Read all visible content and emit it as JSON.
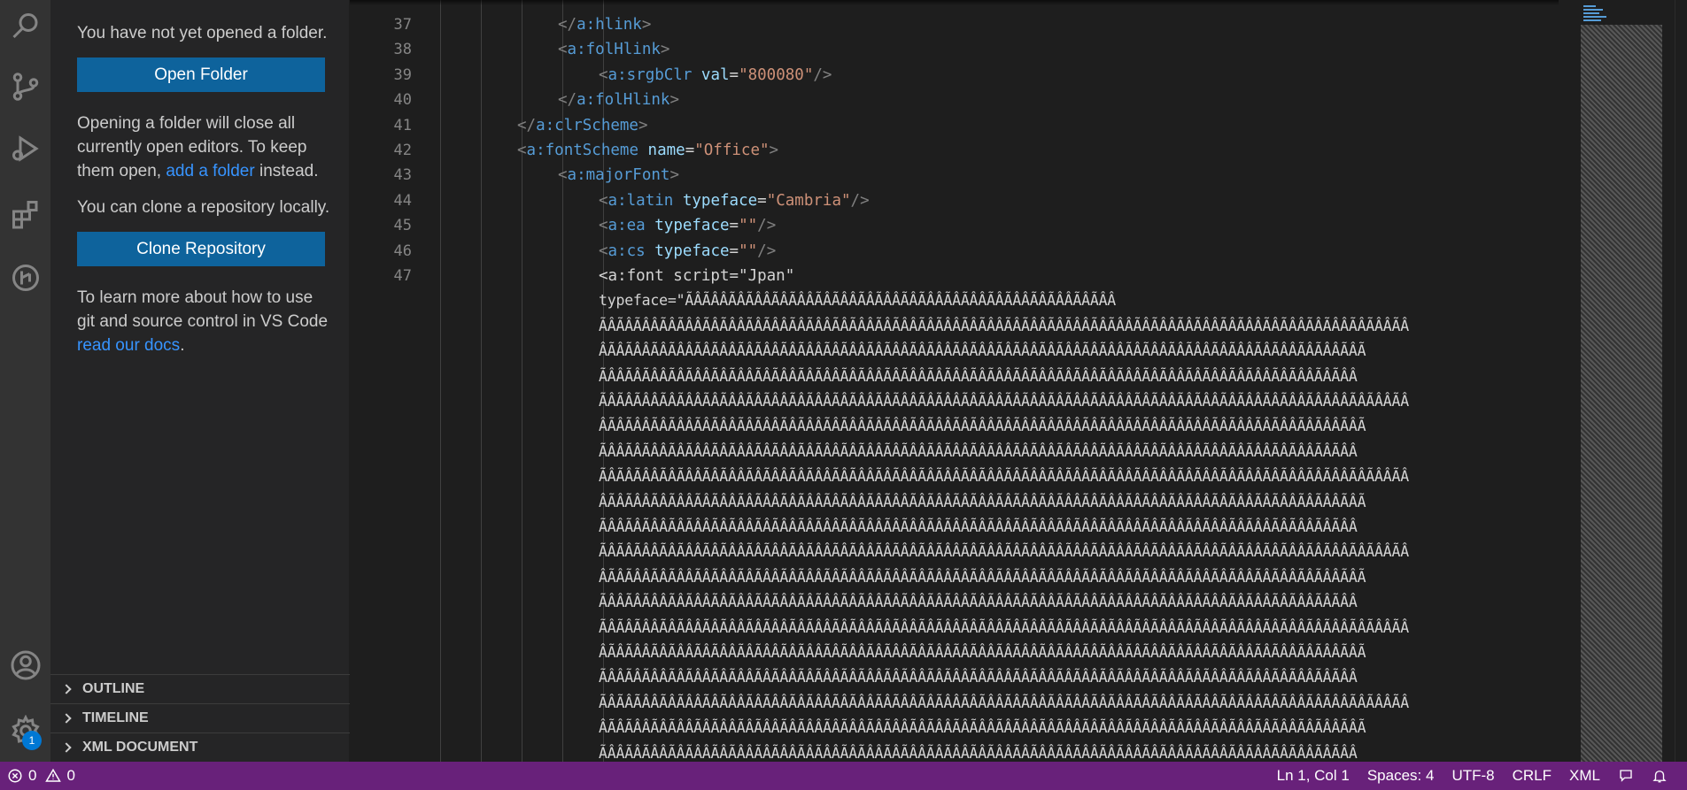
{
  "sidebar": {
    "welcome_text_1": "You have not yet opened a folder.",
    "open_folder_label": "Open Folder",
    "welcome_text_2_pre": "Opening a folder will close all currently open editors. To keep them open, ",
    "welcome_text_2_link": "add a folder",
    "welcome_text_2_post": " instead.",
    "welcome_text_3": "You can clone a repository locally.",
    "clone_repo_label": "Clone Repository",
    "welcome_text_4_pre": "To learn more about how to use git and source control in VS Code ",
    "welcome_text_4_link": "read our docs",
    "welcome_text_4_post": ".",
    "panels": [
      {
        "label": "OUTLINE"
      },
      {
        "label": "TIMELINE"
      },
      {
        "label": "XML DOCUMENT"
      }
    ]
  },
  "activity_bar": {
    "icons": [
      "search-icon",
      "source-control-icon",
      "run-debug-icon",
      "extensions-icon",
      "remote-explorer-icon",
      "account-icon",
      "manage-gear-icon"
    ],
    "badge_count": "1"
  },
  "editor": {
    "line_numbers": [
      "37",
      "38",
      "39",
      "40",
      "41",
      "42",
      "43",
      "44",
      "45",
      "46",
      "47"
    ],
    "lines": {
      "l37": {
        "open": "</",
        "tag": "a:hlink",
        "close": ">"
      },
      "l38": {
        "open": "<",
        "tag": "a:folHlink",
        "close": ">"
      },
      "l39": {
        "open": "<",
        "tag": "a:srgbClr",
        "attr": "val",
        "eq": "=",
        "val": "\"800080\"",
        "close": "/>"
      },
      "l40": {
        "open": "</",
        "tag": "a:folHlink",
        "close": ">"
      },
      "l41": {
        "open": "</",
        "tag": "a:clrScheme",
        "close": ">"
      },
      "l42": {
        "open": "<",
        "tag": "a:fontScheme",
        "attr": "name",
        "eq": "=",
        "val": "\"Office\"",
        "close": ">"
      },
      "l43": {
        "open": "<",
        "tag": "a:majorFont",
        "close": ">"
      },
      "l44": {
        "open": "<",
        "tag": "a:latin",
        "attr": "typeface",
        "eq": "=",
        "val": "\"Cambria\"",
        "close": "/>"
      },
      "l45": {
        "open": "<",
        "tag": "a:ea",
        "attr": "typeface",
        "eq": "=",
        "val": "\"\"",
        "close": "/>"
      },
      "l46": {
        "open": "<",
        "tag": "a:cs",
        "attr": "typeface",
        "eq": "=",
        "val": "\"\"",
        "close": "/>"
      },
      "l47": {
        "text": "<a:font script=\"Jpan\""
      },
      "l47_typeface": "typeface=\"ÃÂÃÂÂÃÂÃÂÂÃÂÃÂÂÃÂÃÂÂÃÂÃÂÂÃÂÃÂÂÃÂÃÂÂÃÂÃÂÂÃÂÃÂÂÃÂÃÂÂ"
    },
    "garbled_row_a": "ÃÂÃÂÃÂÂÃÂÃÂÂÃÂÃÂÂÃÂÃÂÂÃÂÃÂÂÃÂÃÂÂÃÂÃÂÂÃÂÃÂÂÃÂÃÂÂÃÂÃÂÂÃÂÃÂÂÃÂÃÂÂÃÂÃÂÂÃÂÃÂÂÃÂÃÂÂÃÂÃÂÂÃÂÃÂÂÃÂÃÂÂÃÂ",
    "garbled_row_b": "ÂÃÂÃÂÂÃÂÃÂÂÃÂÃÂÂÃÂÃÂÂÃÂÃÂÂÃÂÃÂÂÃÂÃÂÂÃÂÃÂÂÃÂÃÂÂÃÂÃÂÂÃÂÃÂÂÃÂÃÂÂÃÂÃÂÂÃÂÃÂÂÃÂÃÂÂÃÂÃÂÂÃÂÃÂÂÃÂÃ",
    "garbled_row_c": "ÃÂÂÃÂÃÂÂÃÂÃÂÂÃÂÃÂÂÃÂÃÂÂÃÂÃÂÂÃÂÃÂÂÃÂÃÂÂÃÂÃÂÂÃÂÃÂÂÃÂÃÂÂÃÂÃÂÂÃÂÃÂÂÃÂÃÂÂÃÂÃÂÂÃÂÃÂÂÃÂÃÂÂÃÂÃÂÂ"
  },
  "statusbar": {
    "errors": "0",
    "warnings": "0",
    "cursor": "Ln 1, Col 1",
    "spaces": "Spaces: 4",
    "encoding": "UTF-8",
    "eol": "CRLF",
    "language": "XML"
  },
  "colors": {
    "statusbar_bg": "#68217a",
    "button_bg": "#0e639c",
    "tag": "#569cd6",
    "attr": "#9cdcfe",
    "value": "#ce9178"
  }
}
